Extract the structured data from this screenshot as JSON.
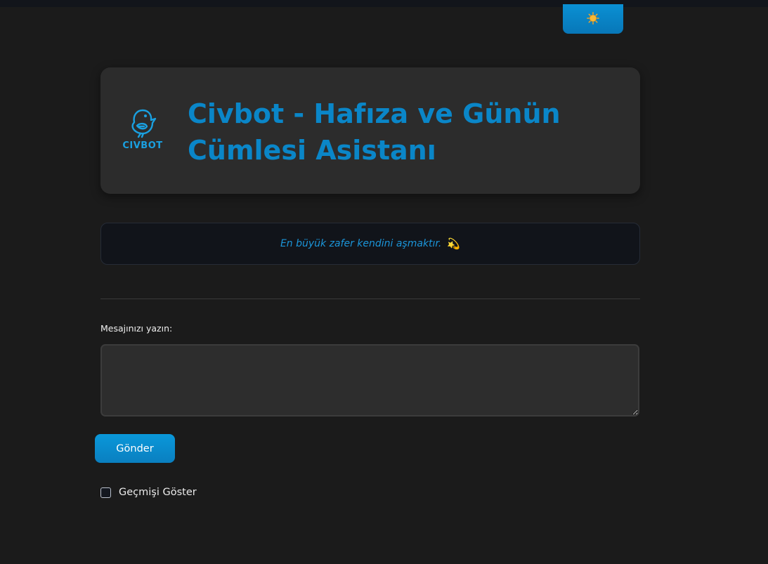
{
  "theme_toggle": {
    "icon": "sun-icon",
    "glyph": "🌞"
  },
  "header": {
    "logo_text": "CIVBOT",
    "title": "Civbot - Hafıza ve Günün Cümlesi Asistanı"
  },
  "quote": {
    "text": "En büyük zafer kendini aşmaktır.",
    "emoji": "💫"
  },
  "form": {
    "label": "Mesajınızı yazın:",
    "value": "",
    "placeholder": "",
    "send_label": "Gönder"
  },
  "history": {
    "label": "Geçmişi Göster",
    "checked": false
  },
  "colors": {
    "accent": "#0a86c8",
    "background": "#1b1b1b",
    "card": "#2c2c2c"
  }
}
